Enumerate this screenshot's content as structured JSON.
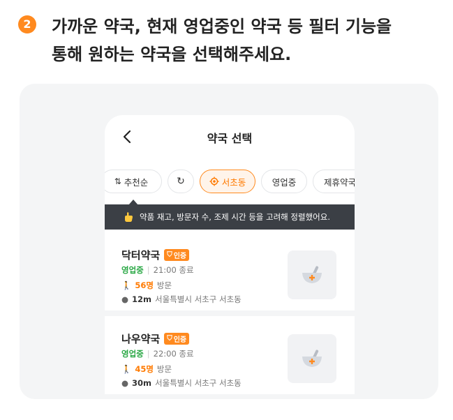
{
  "step": {
    "number": "2",
    "line1": "가까운 약국, 현재 영업중인 약국 등 필터 기능을",
    "line2": "통해 원하는 약국을 선택해주세요."
  },
  "screen": {
    "title": "약국 선택",
    "filters": [
      {
        "icon": "sort-icon",
        "label": "추천순"
      },
      {
        "icon": "refresh-icon",
        "label": ""
      },
      {
        "icon": "location-target-icon",
        "label": "서초동"
      },
      {
        "icon": "",
        "label": "영업중"
      },
      {
        "icon": "",
        "label": "제휴약국"
      }
    ],
    "tooltip": "약품 재고, 방문자 수, 조제 시간 등을 고려해 정렬했어요.",
    "pharmacies": [
      {
        "name": "닥터약국",
        "badge": "인증",
        "status": "영업중",
        "hours": "21:00 종료",
        "visits_count": "56명",
        "visits_label": "방문",
        "distance": "12m",
        "address": "서울특별시 서초구 서초동"
      },
      {
        "name": "나우약국",
        "badge": "인증",
        "status": "영업중",
        "hours": "22:00 종료",
        "visits_count": "45명",
        "visits_label": "방문",
        "distance": "30m",
        "address": "서울특별시 서초구 서초동"
      }
    ]
  },
  "colors": {
    "accent": "#ff8a1f",
    "open": "#2aa845",
    "tooltip_bg": "#3b3f45"
  }
}
